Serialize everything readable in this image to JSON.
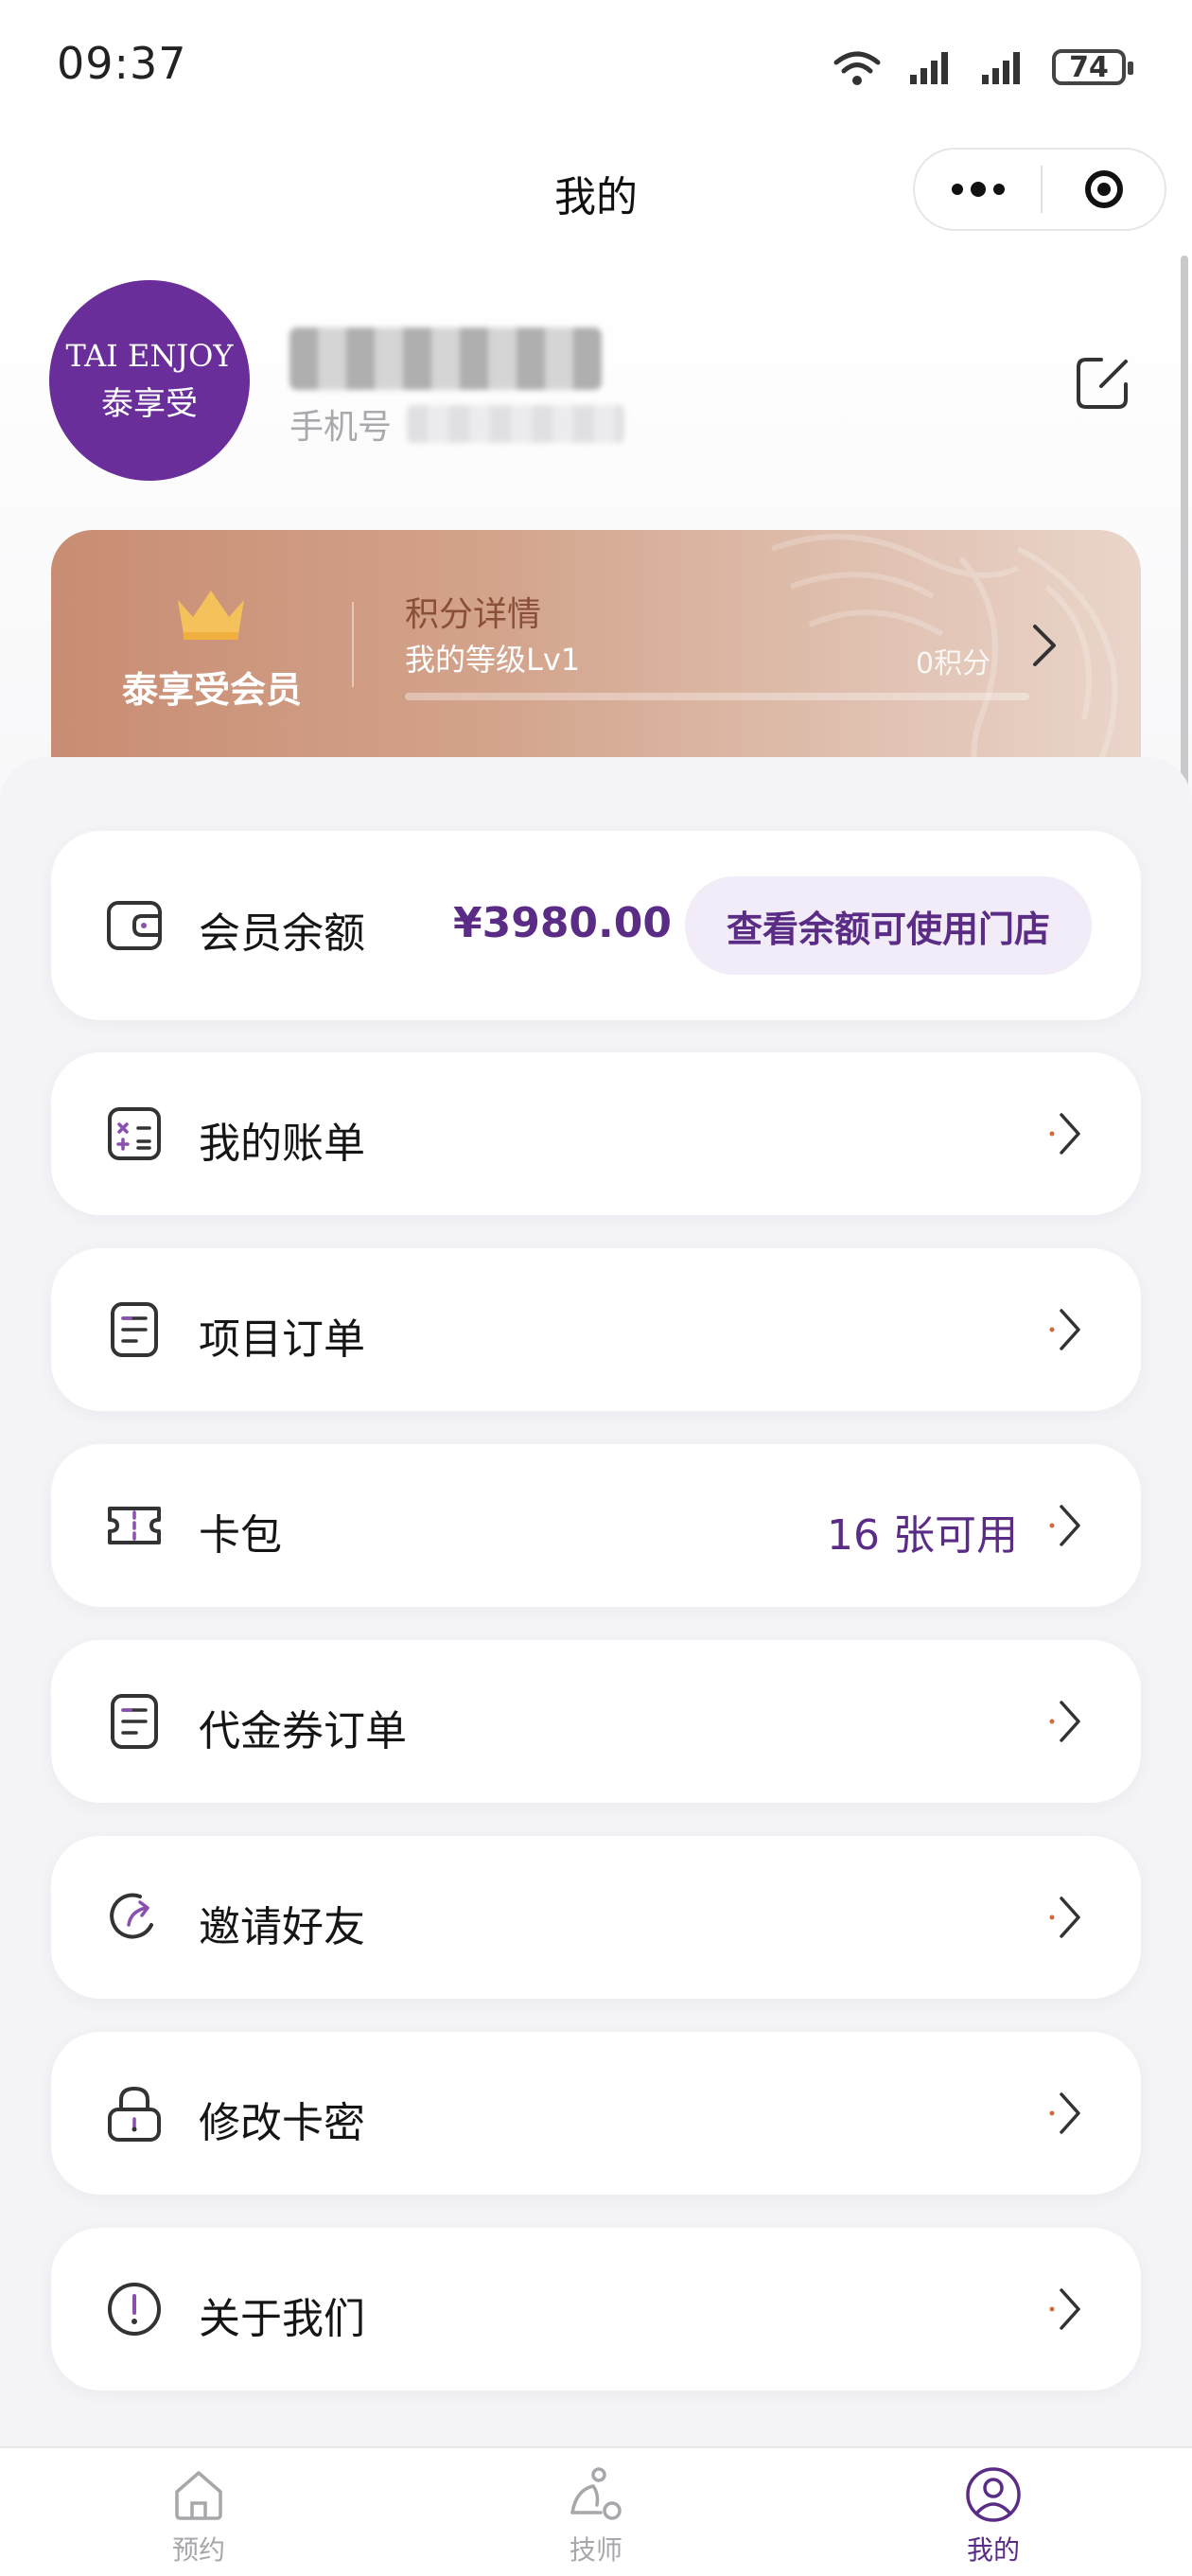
{
  "status_bar": {
    "time": "09:37",
    "battery": "74"
  },
  "nav": {
    "title": "我的"
  },
  "profile": {
    "avatar_brand": "TAI ENJOY",
    "avatar_brand_cn": "泰享受",
    "phone_label": "手机号"
  },
  "member_card": {
    "title": "泰享受会员",
    "points_title": "积分详情",
    "level": "我的等级Lv1",
    "points": "0积分",
    "level_progress": 0
  },
  "balance": {
    "label": "会员余额",
    "amount": "¥3980.00",
    "stores_button": "查看余额可使用门店"
  },
  "menu": {
    "bills": "我的账单",
    "project_orders": "项目订单",
    "card_wallet": "卡包",
    "card_wallet_count": "16 张可用",
    "voucher_orders": "代金券订单",
    "invite": "邀请好友",
    "change_password": "修改卡密",
    "about": "关于我们"
  },
  "tabs": {
    "booking": "预约",
    "technician": "技师",
    "mine": "我的"
  },
  "colors": {
    "brand": "#5a2c86",
    "avatar": "#6a2e9a",
    "card_start": "#c88d73",
    "card_end": "#ead5ca"
  }
}
